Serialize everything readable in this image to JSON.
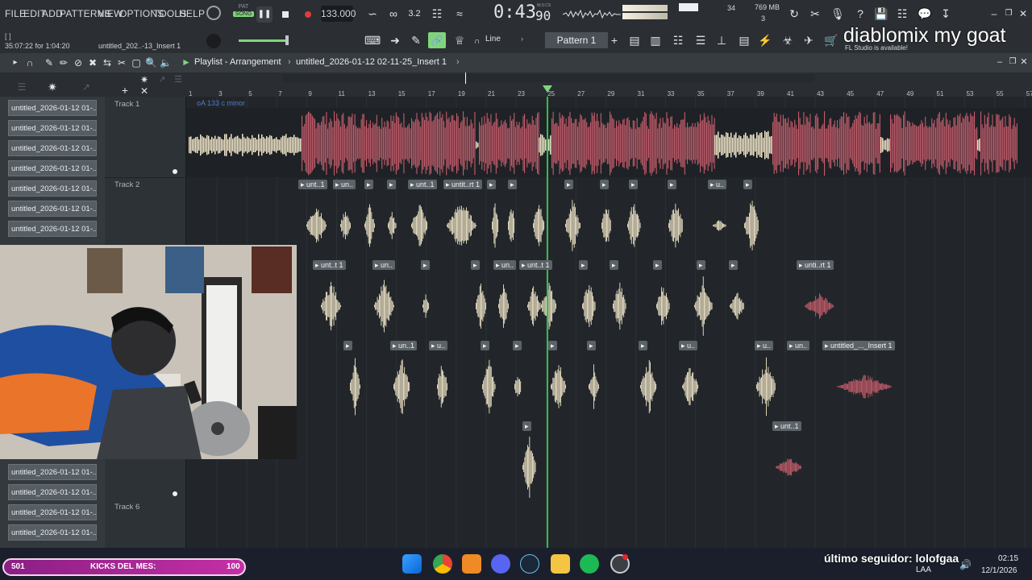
{
  "menu": [
    "FILE",
    "EDIT",
    "ADD",
    "PATTERNS",
    "VIEW",
    "OPTIONS",
    "TOOLS",
    "HELP"
  ],
  "transport": {
    "pat_label": "PAT",
    "song_label": "SONG",
    "tempo": "133.000",
    "time_main": "0:43",
    "time_sub": "90",
    "time_unit": "M:S:CS",
    "cpu_value": "34",
    "memory": "769 MB",
    "polyphony": "3"
  },
  "hint": {
    "line1": "35:07:22 for 1:04:20",
    "line2": "untitled_202..-13_Insert 1"
  },
  "toolbar": {
    "snap_mode": "Line",
    "pattern_name": "Pattern 1",
    "update_notice": "FL Studio is available!"
  },
  "overlay_title": "diablomix my goat",
  "playlist": {
    "title": "Playlist - Arrangement",
    "breadcrumb": "untitled_2026-01-12 02-11-25_Insert 1",
    "key_label": "oA 133 c minor"
  },
  "ruler_ticks": [
    "1",
    "3",
    "5",
    "7",
    "9",
    "11",
    "13",
    "15",
    "17",
    "19",
    "21",
    "23",
    "25",
    "27",
    "29",
    "31",
    "33",
    "35",
    "37",
    "39",
    "41",
    "43",
    "45",
    "47",
    "49",
    "51",
    "53",
    "55",
    "57"
  ],
  "tracks": [
    "Track 1",
    "Track 2",
    "Track 6"
  ],
  "browser_items": [
    "untitled_2026-01-12 01-...",
    "untitled_2026-01-12 01-...",
    "untitled_2026-01-12 01-...",
    "untitled_2026-01-12 01-...",
    "untitled_2026-01-12 01-...",
    "untitled_2026-01-12 01-...",
    "untitled_2026-01-12 01-...",
    "untitled_2026-01-12 01-...",
    "untitled_2026-01-12 01-...",
    "untitled_2026-01-12 01-...",
    "untitled_2026-01-12 01-..."
  ],
  "clip_labels": {
    "row2": [
      "unt..1",
      "un..",
      "",
      "",
      "unt..1",
      "untit..rt 1",
      "",
      "",
      "",
      "",
      "",
      "",
      "u..",
      ""
    ],
    "row3": [
      "unt..t 1",
      "un..",
      "",
      "",
      "un..",
      "unt..t 1",
      "",
      "",
      "",
      "",
      "",
      "unti..rt 1"
    ],
    "row4": [
      "",
      "un..1",
      "u..",
      "",
      "",
      "",
      "",
      "",
      "u..",
      "u..",
      "un..",
      "untitled_..._Insert 1"
    ],
    "row5": [
      "",
      "unt..1"
    ]
  },
  "stream": {
    "follower_text": "último seguidor: lolofgaa",
    "goal_left": "501",
    "goal_label": "KICKS DEL MES:",
    "goal_right": "100"
  },
  "tray": {
    "language": "LAA",
    "time": "02:15",
    "date": "12/1/2026"
  },
  "colors": {
    "accent_green": "#7fd67a",
    "record_red": "#e23b3b",
    "clip_pink": "#c45c6b",
    "clip_cream": "#f1e6c9",
    "playhead": "#2fbf4a",
    "goal_magenta": "#b3279b"
  }
}
